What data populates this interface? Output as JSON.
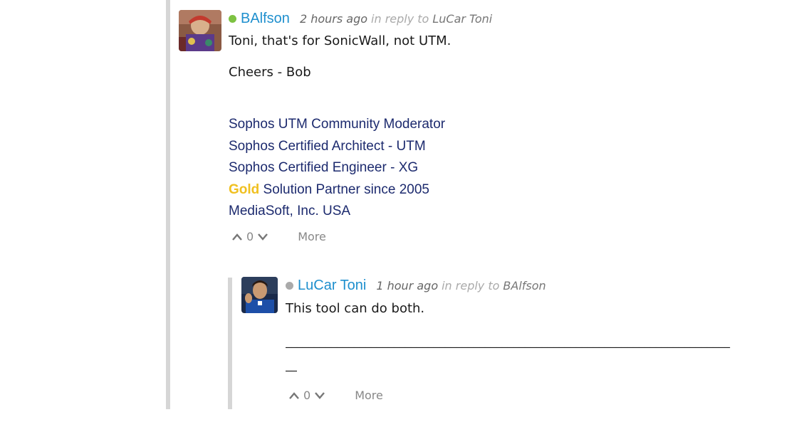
{
  "comment1": {
    "author": "BAlfson",
    "presence_color": "#7dc242",
    "time": "2 hours ago",
    "reply_label": "in reply to",
    "reply_to": "LuCar Toni",
    "body": [
      "Toni, that's for SonicWall, not UTM.",
      "Cheers - Bob"
    ],
    "signature": {
      "line1": "Sophos UTM Community Moderator",
      "line2": "Sophos Certified Architect - UTM",
      "line3": "Sophos Certified Engineer - XG",
      "gold_word": "Gold",
      "line4_rest": " Solution Partner since 2005",
      "line5": "MediaSoft, Inc. USA"
    },
    "vote_count": "0",
    "more_label": "More",
    "upvote_icon": "chevron-up-icon",
    "downvote_icon": "chevron-down-icon"
  },
  "comment2": {
    "author": "LuCar Toni",
    "presence_color": "#aaaaaa",
    "time": "1 hour ago",
    "reply_label": "in reply to",
    "reply_to": "BAlfson",
    "body": "This tool can do both.",
    "rule_line1": "______________________________________________________________________________",
    "rule_line2": "__",
    "vote_count": "0",
    "more_label": "More"
  },
  "colors": {
    "author": "#1e8fce",
    "signature": "#1c2a6e",
    "gold": "#f0c020",
    "thread_bar": "#d6d6d6"
  }
}
